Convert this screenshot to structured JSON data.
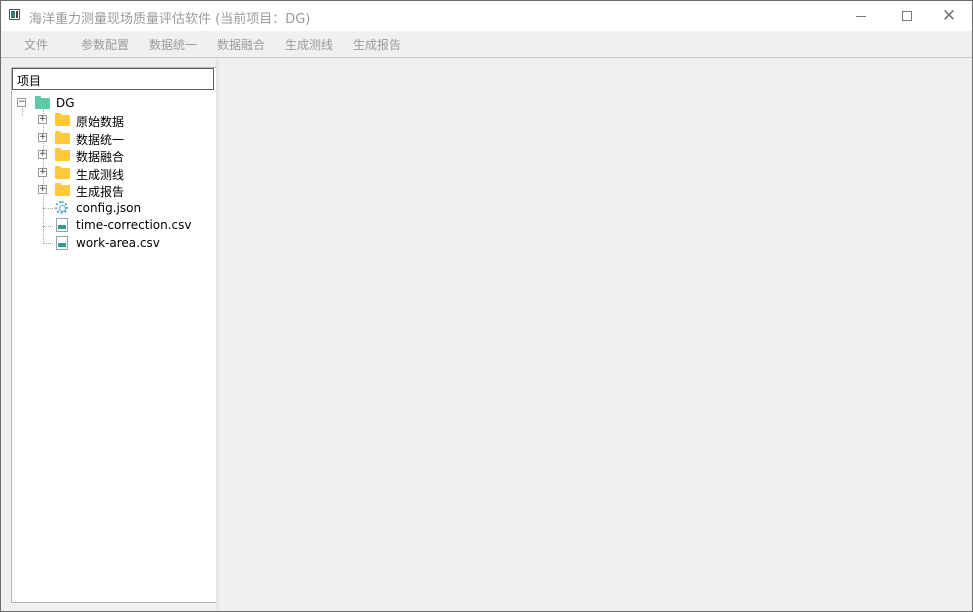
{
  "window": {
    "title": "海洋重力测量现场质量评估软件 (当前项目：DG)",
    "minimize_symbol": "—",
    "close_symbol": "✕"
  },
  "menubar": {
    "items": [
      "文件",
      "参数配置",
      "数据统一",
      "数据融合",
      "生成测线",
      "生成报告"
    ]
  },
  "tree": {
    "header": "项目",
    "root": {
      "label": "DG",
      "icon": "folder-open-icon",
      "expander": "−"
    },
    "folders": [
      {
        "label": "原始数据",
        "expander": "+"
      },
      {
        "label": "数据统一",
        "expander": "+"
      },
      {
        "label": "数据融合",
        "expander": "+"
      },
      {
        "label": "生成测线",
        "expander": "+"
      },
      {
        "label": "生成报告",
        "expander": "+"
      }
    ],
    "files": [
      {
        "label": "config.json",
        "icon": "gear-icon"
      },
      {
        "label": "time-correction.csv",
        "icon": "csv-icon"
      },
      {
        "label": "work-area.csv",
        "icon": "csv-icon"
      }
    ]
  },
  "colors": {
    "folder": "#ffc83d",
    "root_folder": "#5ec9a6",
    "menu_text": "#9b9b9b"
  }
}
